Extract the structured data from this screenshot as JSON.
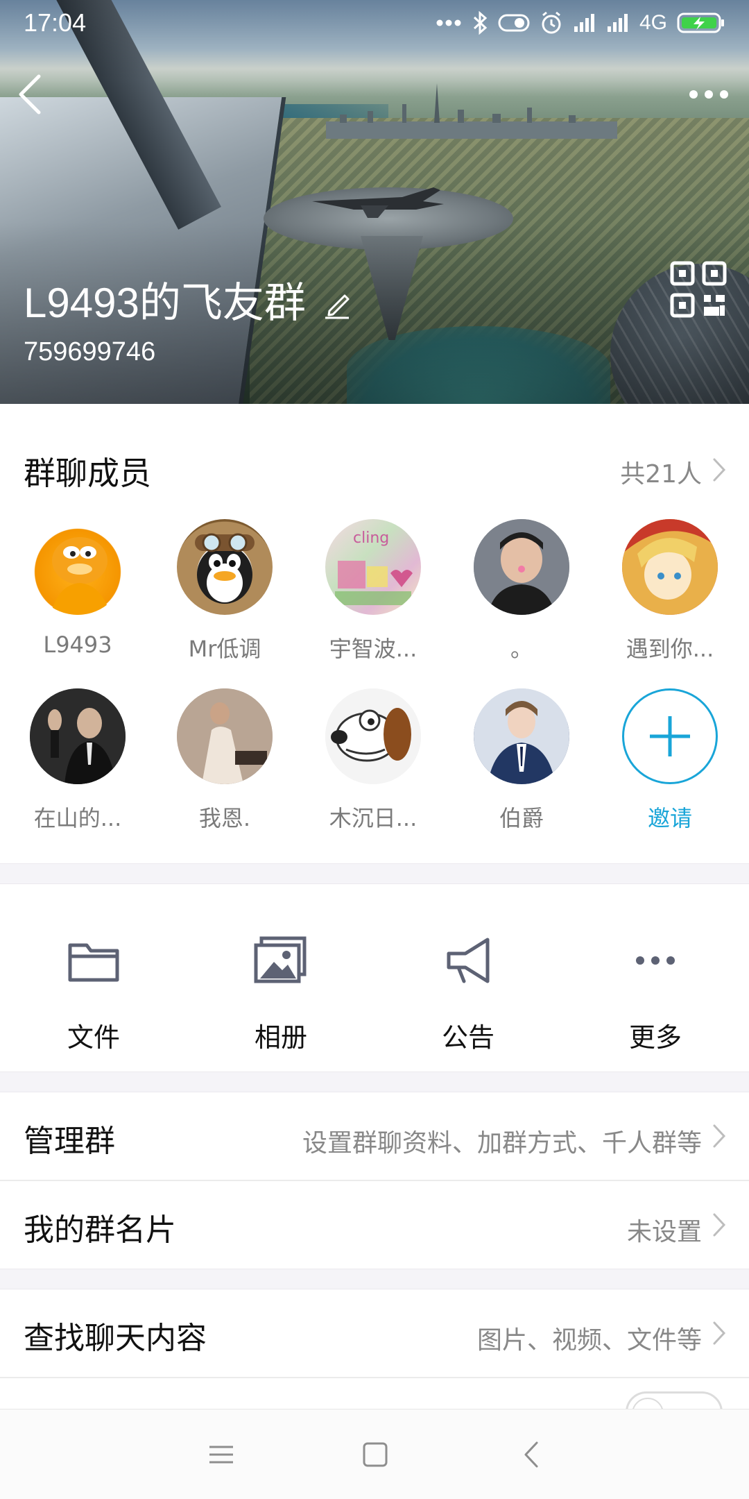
{
  "status_bar": {
    "time": "17:04",
    "network": "4G"
  },
  "header": {
    "group_name": "L9493的飞友群",
    "group_id": "759699746"
  },
  "members": {
    "title": "群聊成员",
    "count_label": "共21人",
    "items": [
      {
        "label": "L9493"
      },
      {
        "label": "Mr低调"
      },
      {
        "label": "宇智波..."
      },
      {
        "label": "。"
      },
      {
        "label": "遇到你..."
      },
      {
        "label": "在山的..."
      },
      {
        "label": "我恩."
      },
      {
        "label": "木沉日..."
      },
      {
        "label": "伯爵"
      }
    ],
    "invite_label": "邀请",
    "accent_color": "#19a5d8"
  },
  "tools": [
    {
      "label": "文件",
      "icon": "folder-icon"
    },
    {
      "label": "相册",
      "icon": "album-icon"
    },
    {
      "label": "公告",
      "icon": "megaphone-icon"
    },
    {
      "label": "更多",
      "icon": "more-dots-icon"
    }
  ],
  "settings": {
    "manage": {
      "label": "管理群",
      "value": "设置群聊资料、加群方式、千人群等"
    },
    "my_card": {
      "label": "我的群名片",
      "value": "未设置"
    },
    "search": {
      "label": "查找聊天内容",
      "value": "图片、视频、文件等"
    }
  }
}
